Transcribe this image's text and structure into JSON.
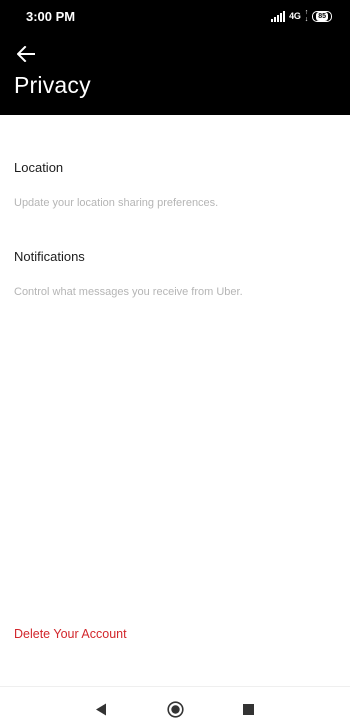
{
  "status_bar": {
    "time": "3:00 PM",
    "network": "4G",
    "battery": "85"
  },
  "header": {
    "back_icon": "arrow-left-icon",
    "title": "Privacy"
  },
  "items": [
    {
      "title": "Location",
      "description": "Update your location sharing preferences."
    },
    {
      "title": "Notifications",
      "description": "Control what messages you receive from Uber."
    }
  ],
  "delete_account": "Delete Your Account",
  "colors": {
    "header_bg": "#000000",
    "delete_text": "#d2262b",
    "description_text": "#b5b5b5"
  },
  "nav": {
    "back_icon": "triangle-back-icon",
    "home_icon": "circle-home-icon",
    "recents_icon": "square-recents-icon"
  }
}
